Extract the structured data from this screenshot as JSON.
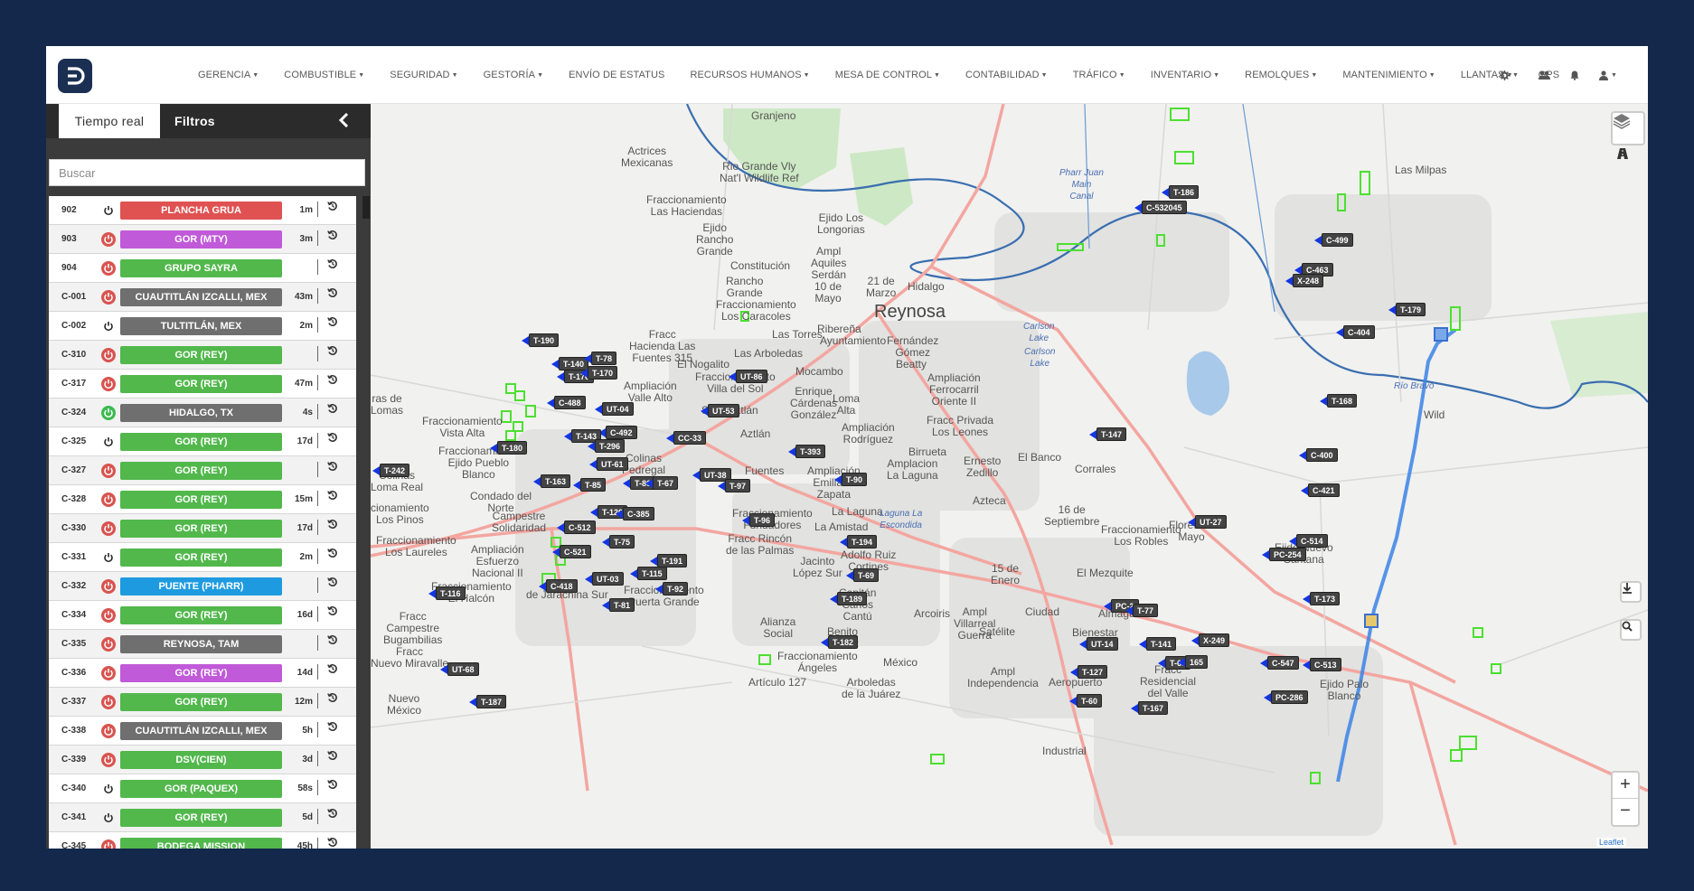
{
  "nav": {
    "items": [
      {
        "label": "GERENCIA",
        "dropdown": true
      },
      {
        "label": "COMBUSTIBLE",
        "dropdown": true
      },
      {
        "label": "SEGURIDAD",
        "dropdown": true
      },
      {
        "label": "GESTORÍA",
        "dropdown": true
      },
      {
        "label": "ENVÍO DE ESTATUS",
        "dropdown": false
      },
      {
        "label": "RECURSOS HUMANOS",
        "dropdown": true
      },
      {
        "label": "MESA DE CONTROL",
        "dropdown": true
      },
      {
        "label": "CONTABILIDAD",
        "dropdown": true
      },
      {
        "label": "TRÁFICO",
        "dropdown": true
      },
      {
        "label": "INVENTARIO",
        "dropdown": true
      },
      {
        "label": "REMOLQUES",
        "dropdown": true
      },
      {
        "label": "MANTENIMIENTO",
        "dropdown": true
      },
      {
        "label": "LLANTAS",
        "dropdown": true
      },
      {
        "label": "GPS",
        "dropdown": false
      }
    ],
    "icons": [
      "gear-icon",
      "users-icon",
      "bell-icon",
      "user-icon"
    ]
  },
  "sidebar": {
    "tabs": {
      "realtime": "Tiempo real",
      "filters": "Filtros"
    },
    "search_placeholder": "Buscar",
    "units": [
      {
        "id": "902",
        "power": "idle",
        "location": "PLANCHA GRUA",
        "color": "#e05252",
        "age": "1m"
      },
      {
        "id": "903",
        "power": "off",
        "location": "GOR (MTY)",
        "color": "#c05ad8",
        "age": "3m"
      },
      {
        "id": "904",
        "power": "off",
        "location": "GRUPO SAYRA",
        "color": "#52b84c",
        "age": ""
      },
      {
        "id": "C-001",
        "power": "off",
        "location": "CUAUTITLÁN IZCALLI, MEX",
        "color": "#6f6f6f",
        "age": "43m"
      },
      {
        "id": "C-002",
        "power": "idle",
        "location": "TULTITLÁN, MEX",
        "color": "#6f6f6f",
        "age": "2m"
      },
      {
        "id": "C-310",
        "power": "off",
        "location": "GOR (REY)",
        "color": "#52b84c",
        "age": ""
      },
      {
        "id": "C-317",
        "power": "off",
        "location": "GOR (REY)",
        "color": "#52b84c",
        "age": "47m"
      },
      {
        "id": "C-324",
        "power": "on",
        "location": "HIDALGO, TX",
        "color": "#6f6f6f",
        "age": "4s"
      },
      {
        "id": "C-325",
        "power": "idle",
        "location": "GOR (REY)",
        "color": "#52b84c",
        "age": "17d"
      },
      {
        "id": "C-327",
        "power": "off",
        "location": "GOR (REY)",
        "color": "#52b84c",
        "age": ""
      },
      {
        "id": "C-328",
        "power": "off",
        "location": "GOR (REY)",
        "color": "#52b84c",
        "age": "15m"
      },
      {
        "id": "C-330",
        "power": "off",
        "location": "GOR (REY)",
        "color": "#52b84c",
        "age": "17d"
      },
      {
        "id": "C-331",
        "power": "idle",
        "location": "GOR (REY)",
        "color": "#52b84c",
        "age": "2m"
      },
      {
        "id": "C-332",
        "power": "off",
        "location": "PUENTE (PHARR)",
        "color": "#1e9be0",
        "age": ""
      },
      {
        "id": "C-334",
        "power": "off",
        "location": "GOR (REY)",
        "color": "#52b84c",
        "age": "16d"
      },
      {
        "id": "C-335",
        "power": "off",
        "location": "REYNOSA, TAM",
        "color": "#6f6f6f",
        "age": ""
      },
      {
        "id": "C-336",
        "power": "off",
        "location": "GOR (REY)",
        "color": "#c05ad8",
        "age": "14d"
      },
      {
        "id": "C-337",
        "power": "off",
        "location": "GOR (REY)",
        "color": "#52b84c",
        "age": "12m"
      },
      {
        "id": "C-338",
        "power": "off",
        "location": "CUAUTITLÁN IZCALLI, MEX",
        "color": "#6f6f6f",
        "age": "5h"
      },
      {
        "id": "C-339",
        "power": "off",
        "location": "DSV(CIEN)",
        "color": "#52b84c",
        "age": "3d"
      },
      {
        "id": "C-340",
        "power": "idle",
        "location": "GOR (PAQUEX)",
        "color": "#52b84c",
        "age": "58s"
      },
      {
        "id": "C-341",
        "power": "idle",
        "location": "GOR (REY)",
        "color": "#52b84c",
        "age": "5d"
      },
      {
        "id": "C-345",
        "power": "off",
        "location": "BODEGA MISSION",
        "color": "#52b84c",
        "age": "45h"
      }
    ]
  },
  "map": {
    "attribution": "Leaflet",
    "places": [
      {
        "name": "Granjeno"
      },
      {
        "name": "Actrices\nMexicanas"
      },
      {
        "name": "Rio Grande Vly\nNat'l Wildlife Ref"
      },
      {
        "name": "Fraccionamiento\nLas Haciendas"
      },
      {
        "name": "Ejido\nRancho\nGrande"
      },
      {
        "name": "Ejido Los\nLongorias"
      },
      {
        "name": "Constitución"
      },
      {
        "name": "Ampl\nAquiles\nSerdán"
      },
      {
        "name": "21 de\nMarzo"
      },
      {
        "name": "Hidalgo"
      },
      {
        "name": "Rancho\nGrande"
      },
      {
        "name": "10 de\nMayo"
      },
      {
        "name": "Reynosa"
      },
      {
        "name": "Fraccionamiento\nLos Caracoles"
      },
      {
        "name": "Las Torres"
      },
      {
        "name": "Ribereña"
      },
      {
        "name": "Ayuntamiento"
      },
      {
        "name": "Fernández\nGómez"
      },
      {
        "name": "Fracc\nHacienda Las\nFuentes 315"
      },
      {
        "name": "Las Arboledas"
      },
      {
        "name": "Beatty"
      },
      {
        "name": "El Nogalito"
      },
      {
        "name": "Mocambo"
      },
      {
        "name": "Fraccionamiento\nVilla del Sol"
      },
      {
        "name": "Ampliación\nValle Alto"
      },
      {
        "name": "Enrique\nCárdenas\nGonzález"
      },
      {
        "name": "Loma\nAlta"
      },
      {
        "name": "Ampliación\nFerrocarril\nOriente II"
      },
      {
        "name": "Fraccionamiento\nVista Alta"
      },
      {
        "name": "Aztlán"
      },
      {
        "name": "Ampliación\nRodríguez"
      },
      {
        "name": "Fracc Privada\nLos Leones"
      },
      {
        "name": "Fraccionamiento\nEjido Pueblo\nBlanco"
      },
      {
        "name": "Colinas\nPedregal"
      },
      {
        "name": "Birrueta"
      },
      {
        "name": "Ernesto\nZedillo"
      },
      {
        "name": "El Banco"
      },
      {
        "name": "Corrales"
      },
      {
        "name": "Ampliación\nEmiliano\nZapata"
      },
      {
        "name": "Amplacion\nLa Laguna"
      },
      {
        "name": "Condado del\nNorte"
      },
      {
        "name": "Campestre\nSolidaridad"
      },
      {
        "name": "Azteca"
      },
      {
        "name": "16 de\nSeptiembre"
      },
      {
        "name": "Fraccionamiento\nLos Laureles"
      },
      {
        "name": "La Laguna"
      },
      {
        "name": "La Amistad"
      },
      {
        "name": "Laguna La\nEscondida"
      },
      {
        "name": "Fraccionamiento\nFundadores"
      },
      {
        "name": "Fracc Rincón\nde las Palmas"
      },
      {
        "name": "Fraccionamiento\nLos Robles"
      },
      {
        "name": "Flores de\nMayo"
      },
      {
        "name": "Ejido Nuevo\nSantana"
      },
      {
        "name": "Ampliación\nEsfuerzo\nNacional II"
      },
      {
        "name": "Adolfo Ruiz\nCortines"
      },
      {
        "name": "Jacinto\nLópez Sur"
      },
      {
        "name": "15 de\nEnero"
      },
      {
        "name": "El Mezquite"
      },
      {
        "name": "Fraccionamiento\nEl Halcón"
      },
      {
        "name": "de Jarachina Sur"
      },
      {
        "name": "Fraccionamiento\nPuerta Grande"
      },
      {
        "name": "Capitán\nCarlos\nCantú"
      },
      {
        "name": "Arcoiris"
      },
      {
        "name": "Ampl\nVillarreal\nGuerra"
      },
      {
        "name": "Ciudad"
      },
      {
        "name": "Almaguer"
      },
      {
        "name": "Fracc\nCampestre\nBugambilias"
      },
      {
        "name": "Alianza\nSocial"
      },
      {
        "name": "Benito\nJuárez"
      },
      {
        "name": "Satélite"
      },
      {
        "name": "Bienestar"
      },
      {
        "name": "Fraccionamiento\nÁngeles"
      },
      {
        "name": "Fracc\nNuevo Miravalle"
      },
      {
        "name": "México"
      },
      {
        "name": "Ampl\nIndependencia"
      },
      {
        "name": "Aeropuerto"
      },
      {
        "name": "Fracc\nResidencial\ndel Valle"
      },
      {
        "name": "Ejido Palo\nBlanco"
      },
      {
        "name": "Artículo 127"
      },
      {
        "name": "Arboledas\nde la Juárez"
      },
      {
        "name": "Nuevo\nMéxico"
      },
      {
        "name": "Industrial"
      },
      {
        "name": "Las Milpas"
      },
      {
        "name": "Pharr Juan\nMain\nCanal"
      },
      {
        "name": "Carlson\nLake"
      },
      {
        "name": "Carlson\nLake"
      },
      {
        "name": "Río Bravo"
      },
      {
        "name": "Wild"
      },
      {
        "name": "ras de\nLomas"
      },
      {
        "name": "Colinas\nLoma Real"
      },
      {
        "name": "cionamiento\nLos Pinos"
      },
      {
        "name": "Fuentes"
      },
      {
        "name": "Secc Aztlán"
      }
    ],
    "vehicles": [
      {
        "label": "T-186"
      },
      {
        "label": "C-532045"
      },
      {
        "label": "C-499"
      },
      {
        "label": "C-463"
      },
      {
        "label": "X-248"
      },
      {
        "label": "T-179"
      },
      {
        "label": "C-404"
      },
      {
        "label": "T-190"
      },
      {
        "label": "T-140"
      },
      {
        "label": "T-78"
      },
      {
        "label": "T-176"
      },
      {
        "label": "T-170"
      },
      {
        "label": "UT-86"
      },
      {
        "label": "C-488"
      },
      {
        "label": "UT-04"
      },
      {
        "label": "UT-53"
      },
      {
        "label": "T-168"
      },
      {
        "label": "C-492"
      },
      {
        "label": "T-143"
      },
      {
        "label": "T-296"
      },
      {
        "label": "CC-33"
      },
      {
        "label": "T-180"
      },
      {
        "label": "T-147"
      },
      {
        "label": "C-400"
      },
      {
        "label": "UT-61"
      },
      {
        "label": "T-393"
      },
      {
        "label": "T-242"
      },
      {
        "label": "T-163"
      },
      {
        "label": "T-85"
      },
      {
        "label": "T-86"
      },
      {
        "label": "T-67"
      },
      {
        "label": "UT-38"
      },
      {
        "label": "T-97"
      },
      {
        "label": "T-90"
      },
      {
        "label": "C-421"
      },
      {
        "label": "T-120"
      },
      {
        "label": "C-385"
      },
      {
        "label": "UT-27"
      },
      {
        "label": "C-512"
      },
      {
        "label": "T-96"
      },
      {
        "label": "C-514"
      },
      {
        "label": "T-75"
      },
      {
        "label": "T-194"
      },
      {
        "label": "PC-254"
      },
      {
        "label": "C-521"
      },
      {
        "label": "T-191"
      },
      {
        "label": "T-115"
      },
      {
        "label": "T-69"
      },
      {
        "label": "T-92"
      },
      {
        "label": "C-418"
      },
      {
        "label": "UT-03"
      },
      {
        "label": "T-116"
      },
      {
        "label": "T-81"
      },
      {
        "label": "T-189"
      },
      {
        "label": "T-173"
      },
      {
        "label": "PC-2"
      },
      {
        "label": "T-77"
      },
      {
        "label": "X-249"
      },
      {
        "label": "T-182"
      },
      {
        "label": "T-141"
      },
      {
        "label": "UT-14"
      },
      {
        "label": "T-65"
      },
      {
        "label": "165"
      },
      {
        "label": "C-547"
      },
      {
        "label": "C-513"
      },
      {
        "label": "UT-68"
      },
      {
        "label": "T-127"
      },
      {
        "label": "PC-286"
      },
      {
        "label": "T-187"
      },
      {
        "label": "T-60"
      },
      {
        "label": "T-167"
      }
    ]
  }
}
